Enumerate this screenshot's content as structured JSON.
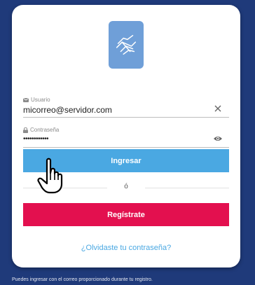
{
  "login": {
    "username_label": "Usuario",
    "username_value": "micorreo@servidor.com",
    "password_label": "Contraseña",
    "password_value": "••••••••••••",
    "login_button": "Ingresar",
    "or_text": "ó",
    "register_button": "Regístrate",
    "forgot_link": "¿Olvidaste tu contraseña?",
    "footnote": "Puedes ingresar con el correo proporcionado durante tu registro."
  },
  "icons": {
    "logo": "handshake-icon",
    "username": "envelope-icon",
    "password": "lock-icon",
    "clear": "close-icon",
    "show_password": "eye-icon",
    "cursor": "hand-pointer-icon"
  },
  "colors": {
    "background": "#1f3a7a",
    "logo": "#6f9fd8",
    "login_button": "#4aa8e2",
    "register_button": "#e3104f",
    "link": "#4aa8e2"
  }
}
